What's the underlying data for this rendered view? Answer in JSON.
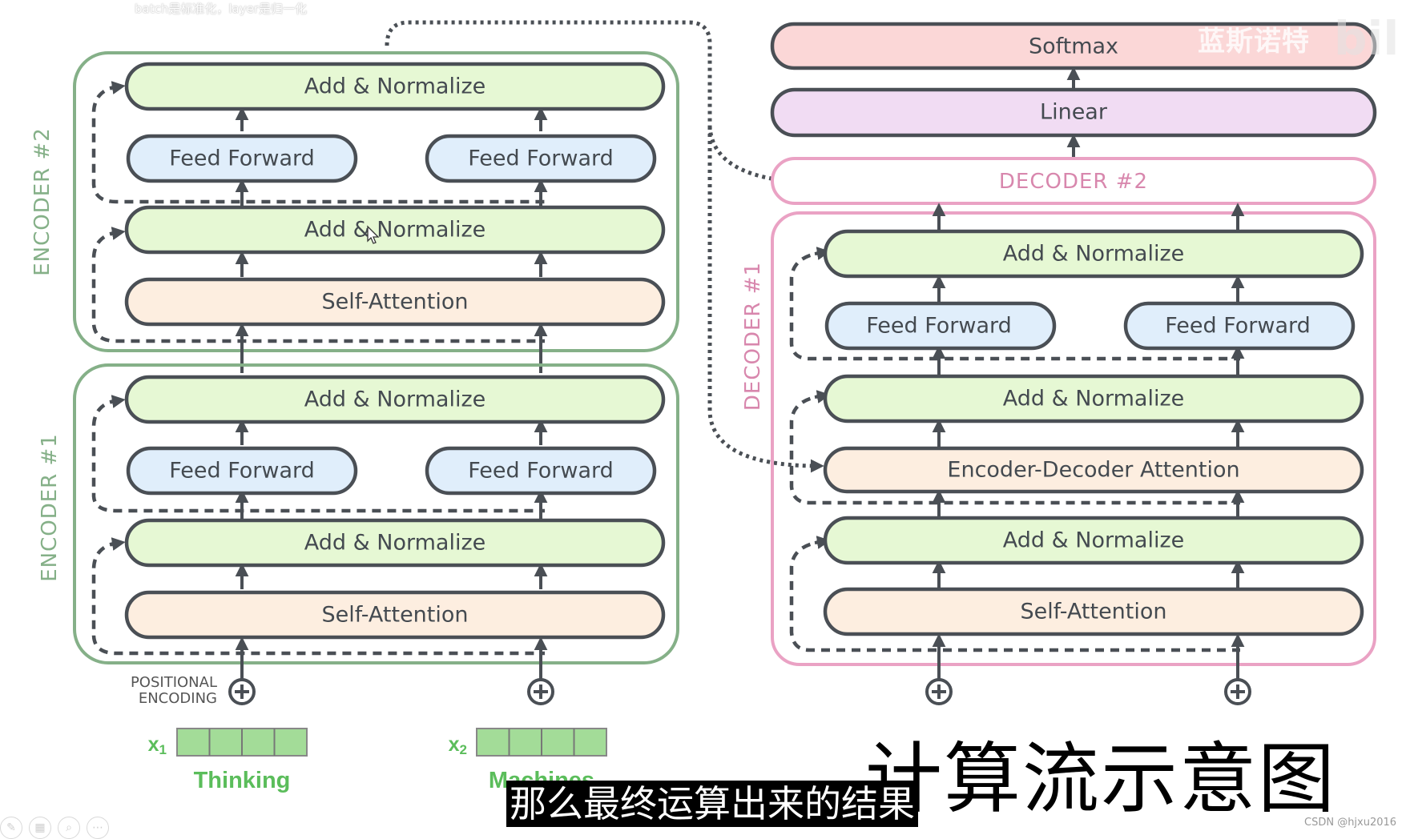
{
  "watermarks": {
    "top_note": "batch是标准化，layer是归一化",
    "brand": "蓝斯诺特",
    "logo": "bili"
  },
  "encoders": [
    {
      "label": "ENCODER #2",
      "color": "#85b088",
      "layers": {
        "top_norm": "Add & Normalize",
        "ffn_left": "Feed Forward",
        "ffn_right": "Feed Forward",
        "mid_norm": "Add & Normalize",
        "attention": "Self-Attention"
      }
    },
    {
      "label": "ENCODER #1",
      "color": "#85b088",
      "layers": {
        "top_norm": "Add & Normalize",
        "ffn_left": "Feed Forward",
        "ffn_right": "Feed Forward",
        "mid_norm": "Add & Normalize",
        "attention": "Self-Attention"
      }
    }
  ],
  "decoders": [
    {
      "label": "DECODER #2",
      "color": "#eaa2c4"
    },
    {
      "label": "DECODER #1",
      "color": "#eaa2c4",
      "layers": {
        "top_norm": "Add & Normalize",
        "ffn_left": "Feed Forward",
        "ffn_right": "Feed Forward",
        "norm2": "Add & Normalize",
        "enc_dec_attention": "Encoder-Decoder Attention",
        "norm1": "Add & Normalize",
        "attention": "Self-Attention"
      }
    }
  ],
  "output_layers": {
    "softmax": "Softmax",
    "linear": "Linear"
  },
  "inputs": {
    "positional_encoding": [
      "POSITIONAL",
      "ENCODING"
    ],
    "tokens": [
      {
        "var": "x",
        "sub": "1",
        "word": "Thinking",
        "cells": 4
      },
      {
        "var": "x",
        "sub": "2",
        "word": "Machines",
        "cells": 4
      }
    ]
  },
  "colors": {
    "norm_fill": "#e6f8d4",
    "ffn_fill": "#e0eefb",
    "attention_fill": "#fdeee0",
    "softmax_fill": "#fbd7d7",
    "linear_fill": "#f1dcf3",
    "outline": "#4a4f55",
    "embedding_fill": "#a3dc98",
    "embedding_text": "#5bbd5b"
  },
  "overlay": {
    "subtitle": "那么最终运算出来的结果",
    "title": "计算流示意图",
    "credit": "CSDN @hjxu2016"
  },
  "toolbar": [
    "pen-tool",
    "layout-tool",
    "zoom-tool",
    "more-tool"
  ]
}
